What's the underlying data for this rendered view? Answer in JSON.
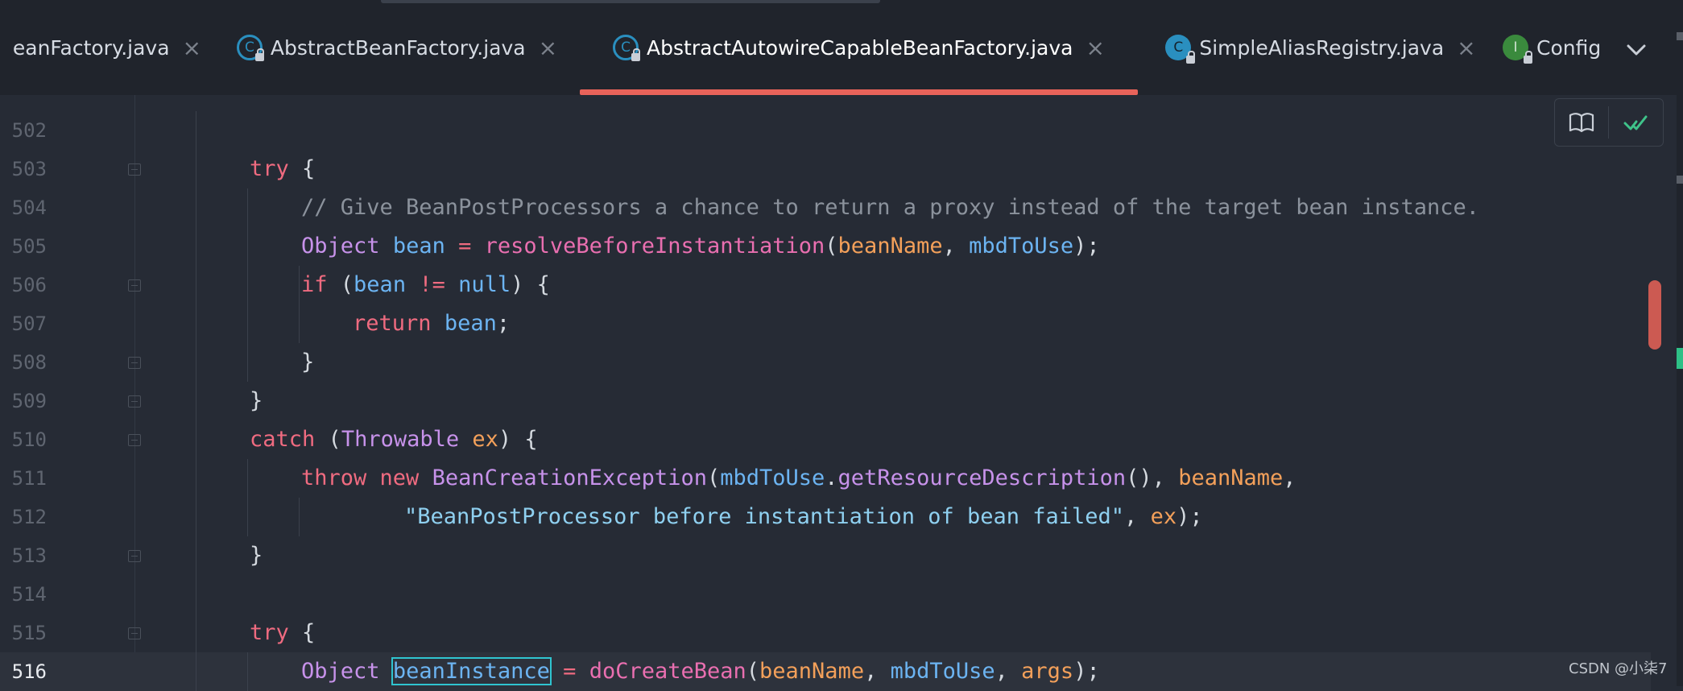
{
  "tabs": [
    {
      "name": "tab-beanfactory",
      "label": "eanFactory.java",
      "icon": "none",
      "glyph": "",
      "active": false
    },
    {
      "name": "tab-abstract-bean-factory",
      "label": "AbstractBeanFactory.java",
      "icon": "class-abstract",
      "glyph": "C",
      "active": false
    },
    {
      "name": "tab-abstract-autowire-capable-bean-factory",
      "label": "AbstractAutowireCapableBeanFactory.java",
      "icon": "class-abstract",
      "glyph": "C",
      "active": true
    },
    {
      "name": "tab-simple-alias-registry",
      "label": "SimpleAliasRegistry.java",
      "icon": "class",
      "glyph": "C",
      "active": false
    },
    {
      "name": "tab-config",
      "label": "Config",
      "icon": "iface",
      "glyph": "I",
      "active": false
    }
  ],
  "tab_close_glyph": "×",
  "colors": {
    "accent_underline": "#e8635a",
    "keyword": "#ef6b80",
    "type": "#c792ea",
    "variable": "#6cb4f2",
    "method": "#e96fb0",
    "parameter": "#f3a05a",
    "string": "#8fd0f0",
    "comment": "#8b929c",
    "background": "#262b35"
  },
  "editor": {
    "current_line": "516",
    "lines": [
      {
        "number": "502",
        "fold": false,
        "indent": 0,
        "tokens": []
      },
      {
        "number": "503",
        "fold": true,
        "indent": 1,
        "tokens": [
          [
            "kw",
            "try"
          ],
          [
            "punct",
            " {"
          ]
        ]
      },
      {
        "number": "504",
        "fold": false,
        "indent": 2,
        "tokens": [
          [
            "cmt",
            "// Give BeanPostProcessors a chance to return a proxy instead of the target bean instance."
          ]
        ]
      },
      {
        "number": "505",
        "fold": false,
        "indent": 2,
        "tokens": [
          [
            "type",
            "Object"
          ],
          [
            "plain",
            " "
          ],
          [
            "var",
            "bean"
          ],
          [
            "plain",
            " "
          ],
          [
            "kw",
            "="
          ],
          [
            "plain",
            " "
          ],
          [
            "fn",
            "resolveBeforeInstantiation"
          ],
          [
            "punct",
            "("
          ],
          [
            "param",
            "beanName"
          ],
          [
            "punct",
            ", "
          ],
          [
            "var",
            "mbdToUse"
          ],
          [
            "punct",
            ");"
          ]
        ]
      },
      {
        "number": "506",
        "fold": true,
        "indent": 2,
        "tokens": [
          [
            "kw",
            "if"
          ],
          [
            "plain",
            " "
          ],
          [
            "punct",
            "("
          ],
          [
            "var",
            "bean"
          ],
          [
            "plain",
            " "
          ],
          [
            "kw",
            "!="
          ],
          [
            "plain",
            " "
          ],
          [
            "var",
            "null"
          ],
          [
            "punct",
            ") {"
          ]
        ]
      },
      {
        "number": "507",
        "fold": false,
        "indent": 3,
        "tokens": [
          [
            "kw",
            "return"
          ],
          [
            "plain",
            " "
          ],
          [
            "var",
            "bean"
          ],
          [
            "punct",
            ";"
          ]
        ]
      },
      {
        "number": "508",
        "fold": true,
        "indent": 2,
        "tokens": [
          [
            "punct",
            "}"
          ]
        ]
      },
      {
        "number": "509",
        "fold": true,
        "indent": 1,
        "tokens": [
          [
            "punct",
            "}"
          ]
        ]
      },
      {
        "number": "510",
        "fold": true,
        "indent": 1,
        "tokens": [
          [
            "kw",
            "catch"
          ],
          [
            "plain",
            " "
          ],
          [
            "punct",
            "("
          ],
          [
            "type",
            "Throwable"
          ],
          [
            "plain",
            " "
          ],
          [
            "param",
            "ex"
          ],
          [
            "punct",
            ") {"
          ]
        ]
      },
      {
        "number": "511",
        "fold": false,
        "indent": 2,
        "tokens": [
          [
            "kw",
            "throw"
          ],
          [
            "plain",
            " "
          ],
          [
            "kw",
            "new"
          ],
          [
            "plain",
            " "
          ],
          [
            "type",
            "BeanCreationException"
          ],
          [
            "punct",
            "("
          ],
          [
            "var",
            "mbdToUse"
          ],
          [
            "punct",
            "."
          ],
          [
            "type",
            "getResourceDescription"
          ],
          [
            "punct",
            "(), "
          ],
          [
            "param",
            "beanName"
          ],
          [
            "punct",
            ","
          ]
        ]
      },
      {
        "number": "512",
        "fold": false,
        "indent": 4,
        "tokens": [
          [
            "str",
            "\"BeanPostProcessor before instantiation of bean failed\""
          ],
          [
            "punct",
            ", "
          ],
          [
            "param",
            "ex"
          ],
          [
            "punct",
            ");"
          ]
        ]
      },
      {
        "number": "513",
        "fold": true,
        "indent": 1,
        "tokens": [
          [
            "punct",
            "}"
          ]
        ]
      },
      {
        "number": "514",
        "fold": false,
        "indent": 0,
        "tokens": []
      },
      {
        "number": "515",
        "fold": true,
        "indent": 1,
        "tokens": [
          [
            "kw",
            "try"
          ],
          [
            "punct",
            " {"
          ]
        ]
      },
      {
        "number": "516",
        "fold": false,
        "indent": 2,
        "tokens": [
          [
            "type",
            "Object"
          ],
          [
            "plain",
            " "
          ],
          [
            "sel",
            "beanInstance"
          ],
          [
            "plain",
            " "
          ],
          [
            "kw",
            "="
          ],
          [
            "plain",
            " "
          ],
          [
            "fn",
            "doCreateBean"
          ],
          [
            "punct",
            "("
          ],
          [
            "param",
            "beanName"
          ],
          [
            "punct",
            ", "
          ],
          [
            "var",
            "mbdToUse"
          ],
          [
            "punct",
            ", "
          ],
          [
            "param",
            "args"
          ],
          [
            "punct",
            ");"
          ]
        ]
      }
    ]
  },
  "widget": {
    "reader_mode_icon": "book-icon",
    "inspection_icon": "check-icon"
  },
  "watermark": "CSDN @小柒7"
}
